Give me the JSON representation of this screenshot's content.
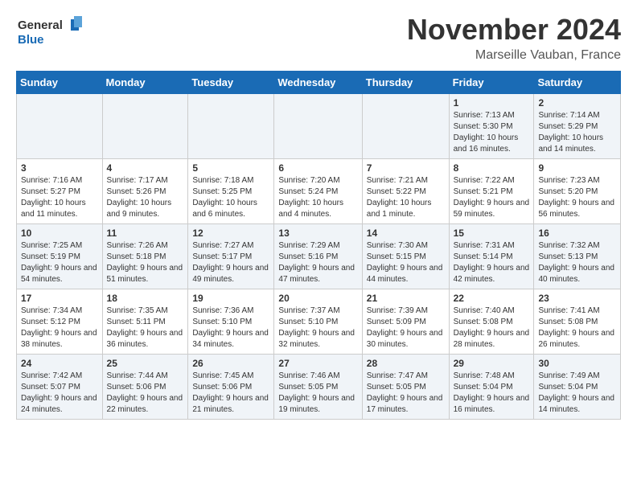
{
  "header": {
    "logo_line1": "General",
    "logo_line2": "Blue",
    "month": "November 2024",
    "location": "Marseille Vauban, France"
  },
  "weekdays": [
    "Sunday",
    "Monday",
    "Tuesday",
    "Wednesday",
    "Thursday",
    "Friday",
    "Saturday"
  ],
  "weeks": [
    [
      {
        "day": "",
        "info": ""
      },
      {
        "day": "",
        "info": ""
      },
      {
        "day": "",
        "info": ""
      },
      {
        "day": "",
        "info": ""
      },
      {
        "day": "",
        "info": ""
      },
      {
        "day": "1",
        "info": "Sunrise: 7:13 AM\nSunset: 5:30 PM\nDaylight: 10 hours and 16 minutes."
      },
      {
        "day": "2",
        "info": "Sunrise: 7:14 AM\nSunset: 5:29 PM\nDaylight: 10 hours and 14 minutes."
      }
    ],
    [
      {
        "day": "3",
        "info": "Sunrise: 7:16 AM\nSunset: 5:27 PM\nDaylight: 10 hours and 11 minutes."
      },
      {
        "day": "4",
        "info": "Sunrise: 7:17 AM\nSunset: 5:26 PM\nDaylight: 10 hours and 9 minutes."
      },
      {
        "day": "5",
        "info": "Sunrise: 7:18 AM\nSunset: 5:25 PM\nDaylight: 10 hours and 6 minutes."
      },
      {
        "day": "6",
        "info": "Sunrise: 7:20 AM\nSunset: 5:24 PM\nDaylight: 10 hours and 4 minutes."
      },
      {
        "day": "7",
        "info": "Sunrise: 7:21 AM\nSunset: 5:22 PM\nDaylight: 10 hours and 1 minute."
      },
      {
        "day": "8",
        "info": "Sunrise: 7:22 AM\nSunset: 5:21 PM\nDaylight: 9 hours and 59 minutes."
      },
      {
        "day": "9",
        "info": "Sunrise: 7:23 AM\nSunset: 5:20 PM\nDaylight: 9 hours and 56 minutes."
      }
    ],
    [
      {
        "day": "10",
        "info": "Sunrise: 7:25 AM\nSunset: 5:19 PM\nDaylight: 9 hours and 54 minutes."
      },
      {
        "day": "11",
        "info": "Sunrise: 7:26 AM\nSunset: 5:18 PM\nDaylight: 9 hours and 51 minutes."
      },
      {
        "day": "12",
        "info": "Sunrise: 7:27 AM\nSunset: 5:17 PM\nDaylight: 9 hours and 49 minutes."
      },
      {
        "day": "13",
        "info": "Sunrise: 7:29 AM\nSunset: 5:16 PM\nDaylight: 9 hours and 47 minutes."
      },
      {
        "day": "14",
        "info": "Sunrise: 7:30 AM\nSunset: 5:15 PM\nDaylight: 9 hours and 44 minutes."
      },
      {
        "day": "15",
        "info": "Sunrise: 7:31 AM\nSunset: 5:14 PM\nDaylight: 9 hours and 42 minutes."
      },
      {
        "day": "16",
        "info": "Sunrise: 7:32 AM\nSunset: 5:13 PM\nDaylight: 9 hours and 40 minutes."
      }
    ],
    [
      {
        "day": "17",
        "info": "Sunrise: 7:34 AM\nSunset: 5:12 PM\nDaylight: 9 hours and 38 minutes."
      },
      {
        "day": "18",
        "info": "Sunrise: 7:35 AM\nSunset: 5:11 PM\nDaylight: 9 hours and 36 minutes."
      },
      {
        "day": "19",
        "info": "Sunrise: 7:36 AM\nSunset: 5:10 PM\nDaylight: 9 hours and 34 minutes."
      },
      {
        "day": "20",
        "info": "Sunrise: 7:37 AM\nSunset: 5:10 PM\nDaylight: 9 hours and 32 minutes."
      },
      {
        "day": "21",
        "info": "Sunrise: 7:39 AM\nSunset: 5:09 PM\nDaylight: 9 hours and 30 minutes."
      },
      {
        "day": "22",
        "info": "Sunrise: 7:40 AM\nSunset: 5:08 PM\nDaylight: 9 hours and 28 minutes."
      },
      {
        "day": "23",
        "info": "Sunrise: 7:41 AM\nSunset: 5:08 PM\nDaylight: 9 hours and 26 minutes."
      }
    ],
    [
      {
        "day": "24",
        "info": "Sunrise: 7:42 AM\nSunset: 5:07 PM\nDaylight: 9 hours and 24 minutes."
      },
      {
        "day": "25",
        "info": "Sunrise: 7:44 AM\nSunset: 5:06 PM\nDaylight: 9 hours and 22 minutes."
      },
      {
        "day": "26",
        "info": "Sunrise: 7:45 AM\nSunset: 5:06 PM\nDaylight: 9 hours and 21 minutes."
      },
      {
        "day": "27",
        "info": "Sunrise: 7:46 AM\nSunset: 5:05 PM\nDaylight: 9 hours and 19 minutes."
      },
      {
        "day": "28",
        "info": "Sunrise: 7:47 AM\nSunset: 5:05 PM\nDaylight: 9 hours and 17 minutes."
      },
      {
        "day": "29",
        "info": "Sunrise: 7:48 AM\nSunset: 5:04 PM\nDaylight: 9 hours and 16 minutes."
      },
      {
        "day": "30",
        "info": "Sunrise: 7:49 AM\nSunset: 5:04 PM\nDaylight: 9 hours and 14 minutes."
      }
    ]
  ]
}
